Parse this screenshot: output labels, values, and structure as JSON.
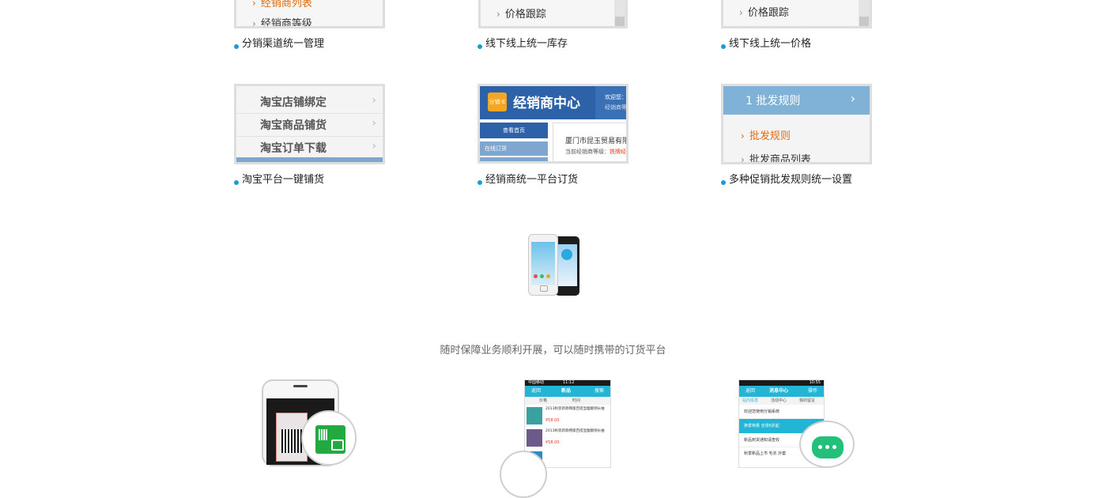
{
  "row1": [
    {
      "menu_top": "经销商列表",
      "menu_bottom": "经销商等级",
      "caption": "分销渠道统一管理"
    },
    {
      "menu": "价格跟踪",
      "caption": "线下线上统一库存"
    },
    {
      "menu": "价格跟踪",
      "caption": "线下线上统一价格"
    }
  ],
  "row2": {
    "taobao": {
      "items": [
        "淘宝店铺绑定",
        "淘宝商品铺货",
        "淘宝订单下载"
      ],
      "caption": "淘宝平台一键铺货"
    },
    "dealer": {
      "logo_text": "分销·E",
      "title": "经销商中心",
      "welcome": "欢迎您：",
      "level": "经销商等级",
      "sidebar_header": "查看首页",
      "sidebar_item": "在线订货",
      "company": "厦门市昆玉贸易有限",
      "level_label": "当前经销商等级：",
      "level_value": "铁牌经销商",
      "caption": "经销商统一平台订货"
    },
    "wholesale": {
      "header": "1 批发规则",
      "items": [
        "批发规则",
        "批发商品列表"
      ],
      "caption": "多种促销批发规则统一设置"
    }
  },
  "slogan": "随时保障业务顺利开展，可以随时携带的订货平台",
  "phones": {
    "mid": {
      "status_carrier": "中国移动",
      "status_time": "11:12",
      "title": "新品",
      "left": "返回",
      "right": "搜索",
      "filter_a": "价格",
      "filter_b": "时间",
      "product": "2013秋装新款韩版百搭显瘦翻领长袖",
      "price": "¥58.00"
    },
    "right": {
      "status_time": "10:55",
      "title": "消息中心",
      "left": "返回",
      "right": "操作",
      "tabs": [
        "站内信息",
        "活动中心",
        "我的留言"
      ],
      "messages": [
        "欢迎您使用分销系统",
        "换季特惠 全场5折起",
        "新品到货通知请查收",
        "秋季新品上市 毛衣 外套"
      ]
    }
  },
  "colors": {
    "accent_dot": "#1a9bd7",
    "blue_header": "#2d62a8",
    "light_blue": "#7fb2d6",
    "green_icon": "#22a940",
    "orange": "#e06b0a"
  }
}
